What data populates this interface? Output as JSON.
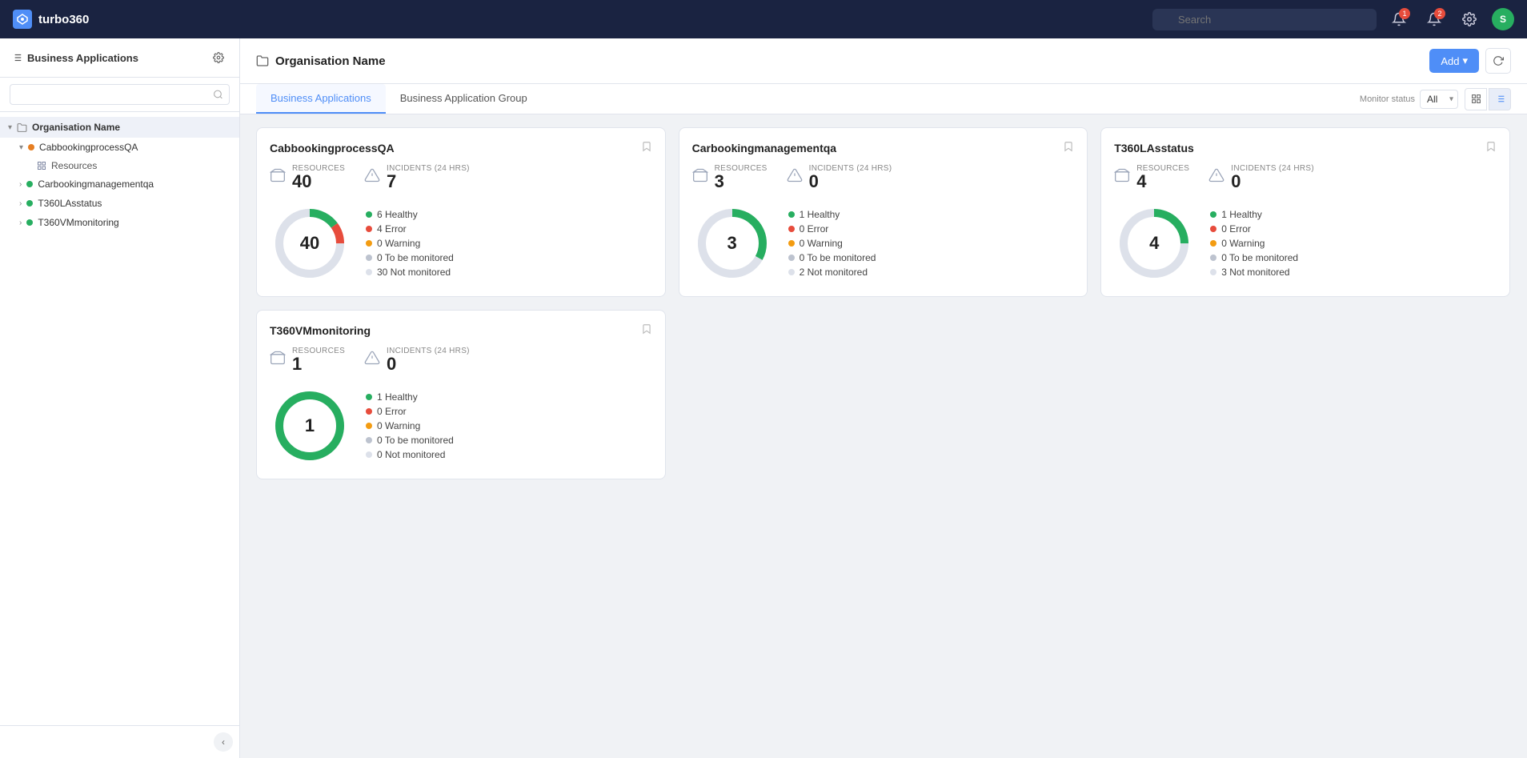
{
  "app": {
    "name": "turbo360",
    "logo_char": "T"
  },
  "topnav": {
    "search_placeholder": "Search",
    "badge1": "1",
    "badge2": "2",
    "user_initial": "S"
  },
  "sidebar": {
    "title": "Business Applications",
    "search_placeholder": "",
    "org_name": "Organisation Name",
    "items": [
      {
        "label": "CabbookingprocessQA",
        "status": "orange",
        "expanded": true,
        "children": [
          {
            "label": "Resources",
            "type": "grid"
          }
        ]
      },
      {
        "label": "Carbookingmanagementqa",
        "status": "green",
        "expanded": false
      },
      {
        "label": "T360LAsstatus",
        "status": "green",
        "expanded": false
      },
      {
        "label": "T360VMmonitoring",
        "status": "green",
        "expanded": false
      }
    ],
    "collapse_icon": "‹"
  },
  "main": {
    "page_title": "Organisation Name",
    "add_btn": "Add",
    "tabs": [
      {
        "label": "Business Applications",
        "active": true
      },
      {
        "label": "Business Application Group",
        "active": false
      }
    ],
    "monitor_filter": {
      "label": "Monitor status",
      "options": [
        "All"
      ],
      "selected": "All"
    }
  },
  "cards": [
    {
      "id": "card1",
      "title": "CabbookingprocessQA",
      "resources": 40,
      "incidents": 7,
      "healthy": 6,
      "error": 4,
      "warning": 0,
      "to_monitor": 0,
      "not_monitor": 30,
      "donut": {
        "healthy_pct": 15,
        "error_pct": 10,
        "warning_pct": 0,
        "to_monitor_pct": 0,
        "not_monitor_pct": 75
      }
    },
    {
      "id": "card2",
      "title": "Carbookingmanagementqa",
      "resources": 3,
      "incidents": 0,
      "healthy": 1,
      "error": 0,
      "warning": 0,
      "to_monitor": 0,
      "not_monitor": 2,
      "donut": {
        "healthy_pct": 33,
        "error_pct": 0,
        "warning_pct": 0,
        "to_monitor_pct": 0,
        "not_monitor_pct": 67
      }
    },
    {
      "id": "card3",
      "title": "T360LAsstatus",
      "resources": 4,
      "incidents": 0,
      "healthy": 1,
      "error": 0,
      "warning": 0,
      "to_monitor": 0,
      "not_monitor": 3,
      "donut": {
        "healthy_pct": 25,
        "error_pct": 0,
        "warning_pct": 0,
        "to_monitor_pct": 0,
        "not_monitor_pct": 75
      }
    },
    {
      "id": "card4",
      "title": "T360VMmonitoring",
      "resources": 1,
      "incidents": 0,
      "healthy": 1,
      "error": 0,
      "warning": 0,
      "to_monitor": 0,
      "not_monitor": 0,
      "donut": {
        "healthy_pct": 100,
        "error_pct": 0,
        "warning_pct": 0,
        "to_monitor_pct": 0,
        "not_monitor_pct": 0
      }
    }
  ],
  "labels": {
    "resources": "Resources",
    "incidents": "Incidents (24 hrs)",
    "healthy": "Healthy",
    "error": "Error",
    "warning": "Warning",
    "to_monitor": "To be monitored",
    "not_monitor": "Not monitored"
  }
}
